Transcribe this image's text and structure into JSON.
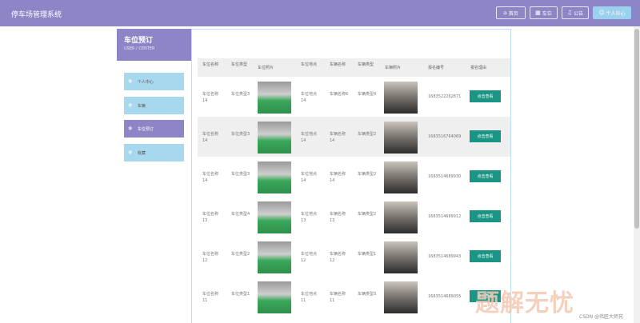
{
  "header": {
    "title": "停车场管理系统",
    "nav": [
      {
        "label": "首页",
        "icon": "home-icon"
      },
      {
        "label": "车位",
        "icon": "parking-icon"
      },
      {
        "label": "公告",
        "icon": "bell-icon"
      },
      {
        "label": "个人中心",
        "icon": "user-icon"
      }
    ]
  },
  "sidebar": {
    "title": "车位预订",
    "subtitle": "USER / CENTER",
    "items": [
      {
        "label": "个人中心",
        "active": false
      },
      {
        "label": "车辆",
        "active": false
      },
      {
        "label": "车位预订",
        "active": true
      },
      {
        "label": "收藏",
        "active": false
      }
    ]
  },
  "table": {
    "headers": [
      "车位名称",
      "车位类型",
      "车位照片",
      "车位地点",
      "车辆名称",
      "车辆类型",
      "车辆照片",
      "报名编号",
      "报名理由"
    ],
    "button_label": "点击查看",
    "rows": [
      {
        "name": "车位名称14",
        "type": "车位类型3",
        "location": "车位地点14",
        "car_name": "车辆名称6",
        "car_type": "车辆类型4",
        "number": "1683522262871"
      },
      {
        "name": "车位名称14",
        "type": "车位类型3",
        "location": "车位地点14",
        "car_name": "车辆名称14",
        "car_type": "车辆类型2",
        "number": "1683516764069"
      },
      {
        "name": "车位名称14",
        "type": "车位类型3",
        "location": "车位地点14",
        "car_name": "车辆名称14",
        "car_type": "车辆类型2",
        "number": "1683514689930"
      },
      {
        "name": "车位名称13",
        "type": "车位类型4",
        "location": "车位地点13",
        "car_name": "车辆名称13",
        "car_type": "车辆类型2",
        "number": "1683514689912"
      },
      {
        "name": "车位名称12",
        "type": "车位类型2",
        "location": "车位地点12",
        "car_name": "车辆名称12",
        "car_type": "车辆类型1",
        "number": "1683514689943"
      },
      {
        "name": "车位名称11",
        "type": "车位类型1",
        "location": "车位地点11",
        "car_name": "车辆名称11",
        "car_type": "车辆类型3",
        "number": "1683514689055"
      }
    ]
  },
  "watermark": "题解无忧",
  "credit": "CSDN @伟匠大师兄"
}
